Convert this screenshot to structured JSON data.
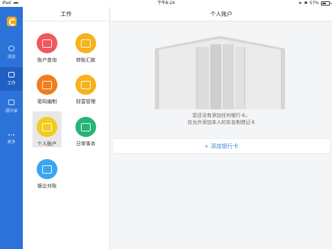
{
  "status_bar": {
    "device": "iPad",
    "time": "下午8:24",
    "battery": "57%",
    "battery_level": 0.57
  },
  "left_nav": {
    "items": [
      {
        "label": "消息",
        "icon": "chat-icon",
        "active": false
      },
      {
        "label": "工作",
        "icon": "work-icon",
        "active": true
      },
      {
        "label": "通讯录",
        "icon": "contacts-icon",
        "active": false
      },
      {
        "label": "更多",
        "icon": "more-icon",
        "active": false
      }
    ]
  },
  "work_panel": {
    "title": "工作",
    "items": [
      {
        "label": "账户查询",
        "color": "#f0575e",
        "icon": "account-query-icon"
      },
      {
        "label": "转账汇款",
        "color": "#f7b21b",
        "icon": "transfer-icon"
      },
      {
        "label": "密码编制",
        "color": "#f07d1e",
        "icon": "lock-icon"
      },
      {
        "label": "财富管理",
        "color": "#f7b21b",
        "icon": "wallet-icon"
      },
      {
        "label": "个人账户",
        "color": "#f2cc1f",
        "icon": "card-icon",
        "selected": true
      },
      {
        "label": "日常事务",
        "color": "#27b474",
        "icon": "document-icon"
      },
      {
        "label": "银企对账",
        "color": "#39a6ef",
        "icon": "reconcile-icon"
      }
    ]
  },
  "content": {
    "title": "个人账户",
    "empty_line1": "您还没有添加任何银行卡。",
    "empty_line2": "仅允许添加本人的实名制借记卡",
    "add_button": "+ 添加银行卡"
  }
}
